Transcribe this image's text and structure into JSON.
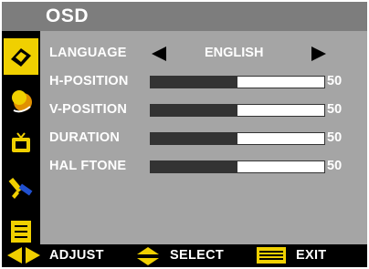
{
  "title": "OSD",
  "sidebar": {
    "items": [
      {
        "icon": "picture-icon",
        "active": true
      },
      {
        "icon": "color-icon",
        "active": false
      },
      {
        "icon": "tv-icon",
        "active": false
      },
      {
        "icon": "wrench-icon",
        "active": false
      },
      {
        "icon": "menu-list-icon",
        "active": false
      }
    ]
  },
  "menu": {
    "language": {
      "label": "LANGUAGE",
      "value": "ENGLISH"
    },
    "h_position": {
      "label": "H-POSITION",
      "value": "50",
      "level": 0.5
    },
    "v_position": {
      "label": "V-POSITION",
      "value": "50",
      "level": 0.5
    },
    "duration": {
      "label": "DURATION",
      "value": "50",
      "level": 0.5
    },
    "halftone": {
      "label": "HAL FTONE",
      "value": "50",
      "level": 0.5
    }
  },
  "footer": {
    "adjust_label": "ADJUST",
    "select_label": "SELECT",
    "exit_label": "EXIT"
  },
  "colors": {
    "title_bar": "#7d7d7d",
    "panel": "#a5a5a5",
    "accent": "#f0d000",
    "bar_fill": "#333333",
    "bar_empty": "#ffffff"
  }
}
